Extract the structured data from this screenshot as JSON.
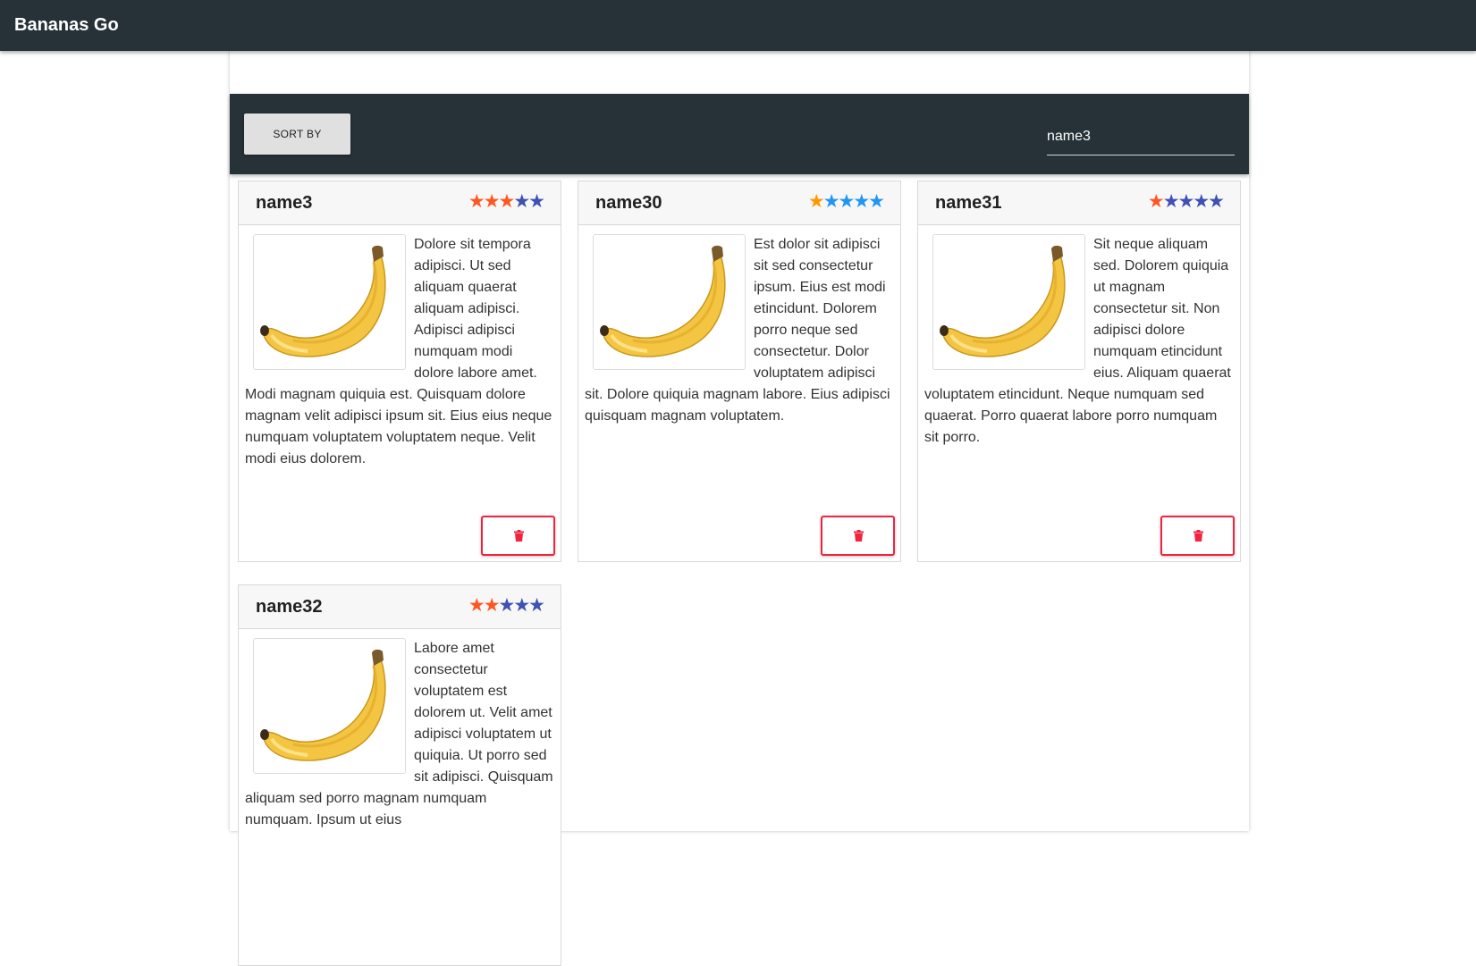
{
  "app": {
    "title": "Bananas Go"
  },
  "toolbar": {
    "sort_label": "SORT BY",
    "search_value": "name3"
  },
  "colors": {
    "appbar": "#263238",
    "delete_accent": "#f0243e",
    "star_orange": "#ff5722",
    "star_indigo": "#3f51b5",
    "star_amber": "#ff9800",
    "star_blue": "#2196f3"
  },
  "cards": [
    {
      "name": "name3",
      "stars": {
        "count": 5,
        "filled": 3,
        "filled_color": "#ff5722",
        "empty_color": "#3f51b5"
      },
      "image_icon": "banana-image",
      "description": "Dolore sit tempora adipisci. Ut sed aliquam quaerat aliquam adipisci. Adipisci adipisci numquam modi dolore labore amet. Modi magnam quiquia est. Quisquam dolore magnam velit adipisci ipsum sit. Eius eius neque numquam voluptatem voluptatem neque. Velit modi eius dolorem.",
      "delete_icon": "trash-icon"
    },
    {
      "name": "name30",
      "stars": {
        "count": 5,
        "filled": 1,
        "filled_color": "#ff9800",
        "empty_color": "#2196f3"
      },
      "image_icon": "banana-image",
      "description": "Est dolor sit adipisci sit sed consectetur ipsum. Eius est modi etincidunt. Dolorem porro neque sed consectetur. Dolor voluptatem adipisci sit. Dolore quiquia magnam labore. Eius adipisci quisquam magnam voluptatem.",
      "delete_icon": "trash-icon"
    },
    {
      "name": "name31",
      "stars": {
        "count": 5,
        "filled": 1,
        "filled_color": "#ff5722",
        "empty_color": "#3f51b5"
      },
      "image_icon": "banana-image",
      "description": "Sit neque aliquam sed. Dolorem quiquia ut magnam consectetur sit. Non adipisci dolore numquam etincidunt eius. Aliquam quaerat voluptatem etincidunt. Neque numquam sed quaerat. Porro quaerat labore porro numquam sit porro.",
      "delete_icon": "trash-icon"
    },
    {
      "name": "name32",
      "stars": {
        "count": 5,
        "filled": 2,
        "filled_color": "#ff5722",
        "empty_color": "#3f51b5"
      },
      "image_icon": "banana-image",
      "description": "Labore amet consectetur voluptatem est dolorem ut. Velit amet adipisci voluptatem ut quiquia. Ut porro sed sit adipisci. Quisquam aliquam sed porro magnam numquam numquam. Ipsum ut eius",
      "delete_icon": "trash-icon"
    }
  ]
}
